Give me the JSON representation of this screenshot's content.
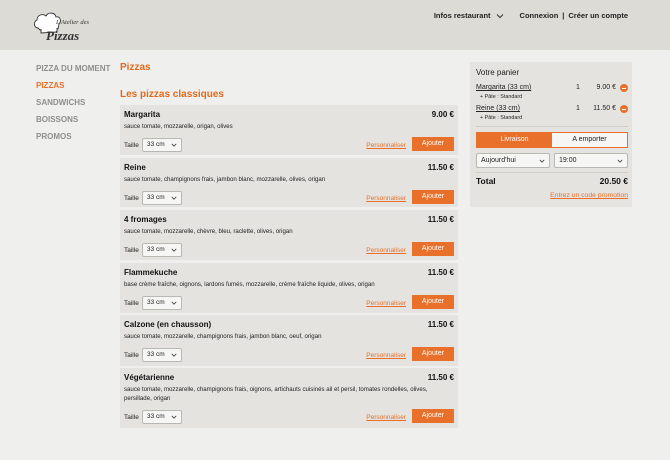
{
  "logo": {
    "text_top": "L'Atelier des",
    "text_main": "Pizzas"
  },
  "header": {
    "infos_label": "Infos restaurant",
    "login_label": "Connexion",
    "separator": "|",
    "register_label": "Créer un compte"
  },
  "sidebar": {
    "items": [
      {
        "label": "PIZZA DU MOMENT",
        "active": false
      },
      {
        "label": "PIZZAS",
        "active": true
      },
      {
        "label": "SANDWICHS",
        "active": false
      },
      {
        "label": "BOISSONS",
        "active": false
      },
      {
        "label": "PROMOS",
        "active": false
      }
    ]
  },
  "main": {
    "title": "Pizzas",
    "section_title": "Les pizzas classiques",
    "size_label": "Taille",
    "customize_label": "Personnaliser",
    "add_label": "Ajouter",
    "products": [
      {
        "name": "Margarita",
        "price": "9.00 €",
        "desc": "sauce tomate, mozzarelle, origan, olives",
        "size": "33 cm"
      },
      {
        "name": "Reine",
        "price": "11.50 €",
        "desc": "sauce tomate, champignons frais, jambon blanc, mozzarelle, olives, origan",
        "size": "33 cm"
      },
      {
        "name": "4 fromages",
        "price": "11.50 €",
        "desc": "sauce tomate, mozzarelle, chèvre, bleu, raclette, olives, origan",
        "size": "33 cm"
      },
      {
        "name": "Flammekuche",
        "price": "11.50 €",
        "desc": "base crème fraîche, oignons, lardons fumés, mozzarelle, crème fraîche liquide, olives, origan",
        "size": "33 cm"
      },
      {
        "name": "Calzone (en chausson)",
        "price": "11.50 €",
        "desc": "sauce tomate, mozzarelle, champignons frais, jambon blanc, oeuf, origan",
        "size": "33 cm"
      },
      {
        "name": "Végétarienne",
        "price": "11.50 €",
        "desc": "sauce tomate, mozzarelle, champignons frais, oignons, artichauts cuisinés ail et persil, tomates rondelles, olives, persillade, origan",
        "size": "33 cm"
      }
    ]
  },
  "cart": {
    "title": "Votre panier",
    "items": [
      {
        "name": "Margarita (33 cm)",
        "sub": "+ Pâte : Standard",
        "qty": "1",
        "price": "9.00 €"
      },
      {
        "name": "Reine (33 cm)",
        "sub": "+ Pâte : Standard",
        "qty": "1",
        "price": "11.50 €"
      }
    ],
    "delivery_label": "Livraison",
    "takeaway_label": "A emporter",
    "day_value": "Aujourd'hui",
    "time_value": "19:00",
    "total_label": "Total",
    "total_value": "20.50 €",
    "promo_label": "Entrez un code promotion"
  },
  "colors": {
    "accent": "#e9702a",
    "header_bg": "#dddbd5",
    "card_bg": "#e4e3df",
    "page_bg": "#efefed"
  },
  "icons": {
    "dropdown": "chevron-down-icon",
    "remove": "minus-circle-icon",
    "logo": "chef-hat-icon"
  }
}
